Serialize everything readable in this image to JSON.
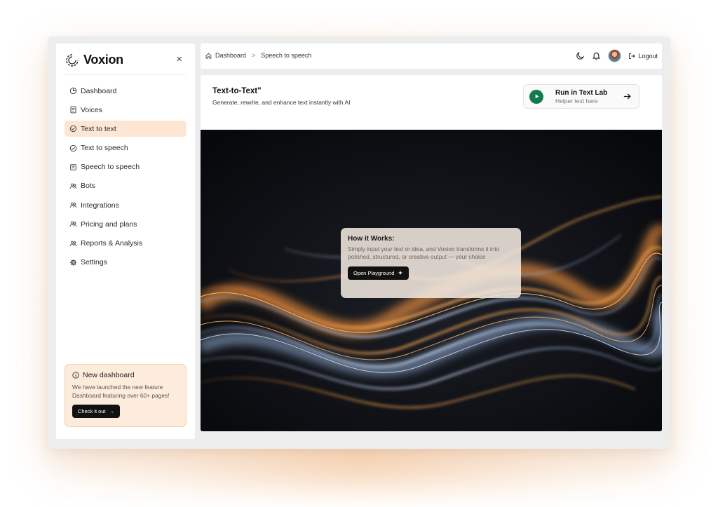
{
  "brand": {
    "name": "Voxion",
    "close_glyph": "×"
  },
  "sidebar": {
    "items": [
      {
        "label": "Dashboard",
        "icon": "dashboard-icon",
        "active": false
      },
      {
        "label": "Voices",
        "icon": "document-icon",
        "active": false
      },
      {
        "label": "Text to text",
        "icon": "check-circle-icon",
        "active": true
      },
      {
        "label": "Text to speech",
        "icon": "check-circle-icon",
        "active": false
      },
      {
        "label": "Speech to speech",
        "icon": "note-icon",
        "active": false
      },
      {
        "label": "Bots",
        "icon": "users-icon",
        "active": false
      },
      {
        "label": "Integrations",
        "icon": "users-icon",
        "active": false
      },
      {
        "label": "Pricing and plans",
        "icon": "users-icon",
        "active": false
      },
      {
        "label": "Reports & Analysis",
        "icon": "users-icon",
        "active": false
      },
      {
        "label": "Settings",
        "icon": "gear-icon",
        "active": false
      }
    ],
    "promo": {
      "title": "New dashboard",
      "text": "We have launched the new feature Dashboard featuring over 60+ pages!",
      "button": "Check it out",
      "arrow": "→"
    }
  },
  "topbar": {
    "breadcrumb": [
      "Dashboard",
      "Speech to speech"
    ],
    "breadcrumb_sep": ">",
    "logout": "Logout"
  },
  "main": {
    "title": "Text-to-Text\"",
    "subtitle": "Generate, rewrite, and enhance text instantly with AI",
    "run": {
      "label": "Run in Text Lab",
      "helper": "Helper text here"
    },
    "how": {
      "title": "How it Works:",
      "text": "Simply input your text or idea, and Voxion transforms it into polished, structured, or creative output — your choice",
      "button": "Open Playground"
    }
  },
  "colors": {
    "accent": "#fde6d4",
    "promo_bg": "#fdebdc",
    "play_green": "#127a4d",
    "hero_bg": "#0a0c11",
    "wave_orange": "#e8913f",
    "wave_blue": "#8ea3c0"
  }
}
